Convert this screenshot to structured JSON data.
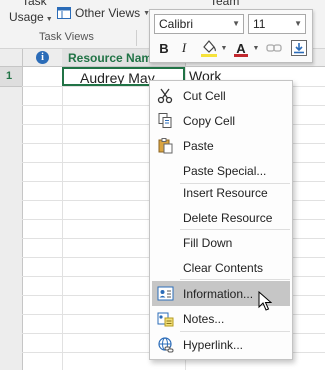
{
  "ribbon": {
    "task_label": "Task",
    "usage_label": "Usage",
    "other_views_label": "Other Views",
    "team_label": "Team",
    "group_label": "Task Views"
  },
  "mini_toolbar": {
    "font": "Calibri",
    "size": "11",
    "bold": "B",
    "italic": "I",
    "font_color_letter": "A"
  },
  "grid": {
    "column_header_name": "Resource Name",
    "row_number": "1",
    "resource_name": "Audrey May",
    "resource_type": "Work"
  },
  "context_menu": {
    "items": [
      {
        "label": "Cut Cell",
        "icon": "scissors-icon"
      },
      {
        "label": "Copy Cell",
        "icon": "copy-icon"
      },
      {
        "label": "Paste",
        "icon": "clipboard-icon"
      },
      {
        "label": "Paste Special...",
        "icon": ""
      },
      {
        "label": "Insert Resource",
        "icon": ""
      },
      {
        "label": "Delete Resource",
        "icon": ""
      },
      {
        "label": "Fill Down",
        "icon": ""
      },
      {
        "label": "Clear Contents",
        "icon": ""
      },
      {
        "label": "Information...",
        "icon": "information-card-icon",
        "highlighted": true
      },
      {
        "label": "Notes...",
        "icon": "notes-icon"
      },
      {
        "label": "Hyperlink...",
        "icon": "hyperlink-icon"
      }
    ]
  },
  "colors": {
    "accent_green": "#217346",
    "info_blue": "#2b6cb8",
    "highlight_gray": "#c6c6c6",
    "fill_yellow": "#f6e23a",
    "font_red": "#c1272d"
  }
}
